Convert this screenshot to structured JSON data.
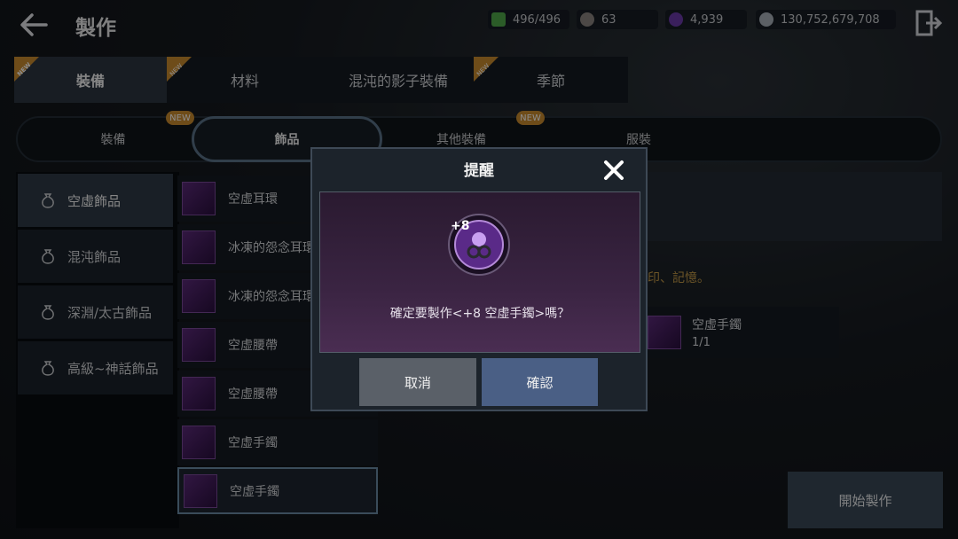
{
  "header": {
    "title": "製作",
    "back_icon": "arrow-left-icon",
    "exit_icon": "exit-door-icon"
  },
  "resources": [
    {
      "name": "stamina",
      "icon": "green-gem-icon",
      "value": "496/496",
      "color": "#4fa84a"
    },
    {
      "name": "stone",
      "icon": "grey-orb-icon",
      "value": "63",
      "color": "#8a8480"
    },
    {
      "name": "crystal",
      "icon": "purple-orb-icon",
      "value": "4,939",
      "color": "#6a3aa8"
    },
    {
      "name": "silver",
      "icon": "silver-coin-icon",
      "value": "130,752,679,708",
      "color": "#a8b0b8"
    }
  ],
  "main_tabs": [
    {
      "label": "裝備",
      "new": true,
      "badge": "NEW",
      "active": true
    },
    {
      "label": "材料",
      "new": true,
      "badge": "NEW",
      "active": false
    },
    {
      "label": "混沌的影子裝備",
      "new": false,
      "active": false
    },
    {
      "label": "季節",
      "new": true,
      "badge": "NEW",
      "active": false
    }
  ],
  "sub_tabs": [
    {
      "label": "裝備",
      "active": false
    },
    {
      "label": "飾品",
      "active": true,
      "badge": "NEW"
    },
    {
      "label": "其他裝備",
      "active": false
    },
    {
      "label": "服裝",
      "active": false,
      "badge": "NEW"
    }
  ],
  "categories": [
    {
      "label": "空虛飾品",
      "active": true
    },
    {
      "label": "混沌飾品",
      "active": false
    },
    {
      "label": "深淵/太古飾品",
      "active": false
    },
    {
      "label": "高級~神話飾品",
      "active": false
    }
  ],
  "items": [
    {
      "label": "空虛耳環"
    },
    {
      "label": "冰凍的怨念耳環"
    },
    {
      "label": "冰凍的怨念耳環"
    },
    {
      "label": "空虛腰帶"
    },
    {
      "label": "空虛腰帶"
    },
    {
      "label": "空虛手鐲"
    },
    {
      "label": "空虛手鐲",
      "selected": true
    }
  ],
  "detail": {
    "note": "印、記憶。",
    "material_name": "空虛手鐲",
    "material_count": "1/1",
    "start_button": "開始製作"
  },
  "dialog": {
    "title": "提醒",
    "enhance_level": "+8",
    "message": "確定要製作<+8 空虛手鐲>嗎？",
    "cancel": "取消",
    "confirm": "確認"
  }
}
